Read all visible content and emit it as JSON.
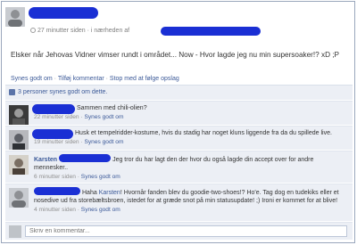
{
  "post": {
    "timestamp": "27 minutter siden · i nærheden af",
    "text": "Elsker når Jehovas Vidner vimser rundt i området... Now - Hvor lagde jeg nu min supersoaker!? xD ;P",
    "actions": [
      "Synes godt om",
      "Tilføj kommentar",
      "Stop med at følge opslag"
    ],
    "likes": "3 personer synes godt om dette."
  },
  "comments": [
    {
      "name": "",
      "text": "Sammen med chili-olien?",
      "time": "22 minutter siden",
      "like": "Synes godt om"
    },
    {
      "name": "",
      "text": "Husk et tempelridder-kostume, hvis du stadig har noget kluns liggende fra da du spillede live.",
      "time": "19 minutter siden",
      "like": "Synes godt om"
    },
    {
      "name": "Karsten",
      "text": "Jeg tror du har lagt den der hvor du også lagde din accept over for andre mennesker..",
      "time": "6 minutter siden",
      "like": "Synes godt om"
    },
    {
      "name": "",
      "text_prefix": "Haha ",
      "mention": "Karsten",
      "text": "! Hvornår fanden blev du goodie-two-shoes!? Ho'e. Tag dog en tudekiks eller et nosedive ud fra storebæltsbroen, istedet for at græde snot på min statusupdate! ;) Ironi er kommet for at blive!",
      "time": "4 minutter siden",
      "like": "Synes godt om"
    }
  ],
  "reply": {
    "placeholder": "Skriv en kommentar..."
  },
  "colors": {
    "link": "#3b5998",
    "redaction": "#1a2fd4",
    "panel": "#eceff5"
  }
}
